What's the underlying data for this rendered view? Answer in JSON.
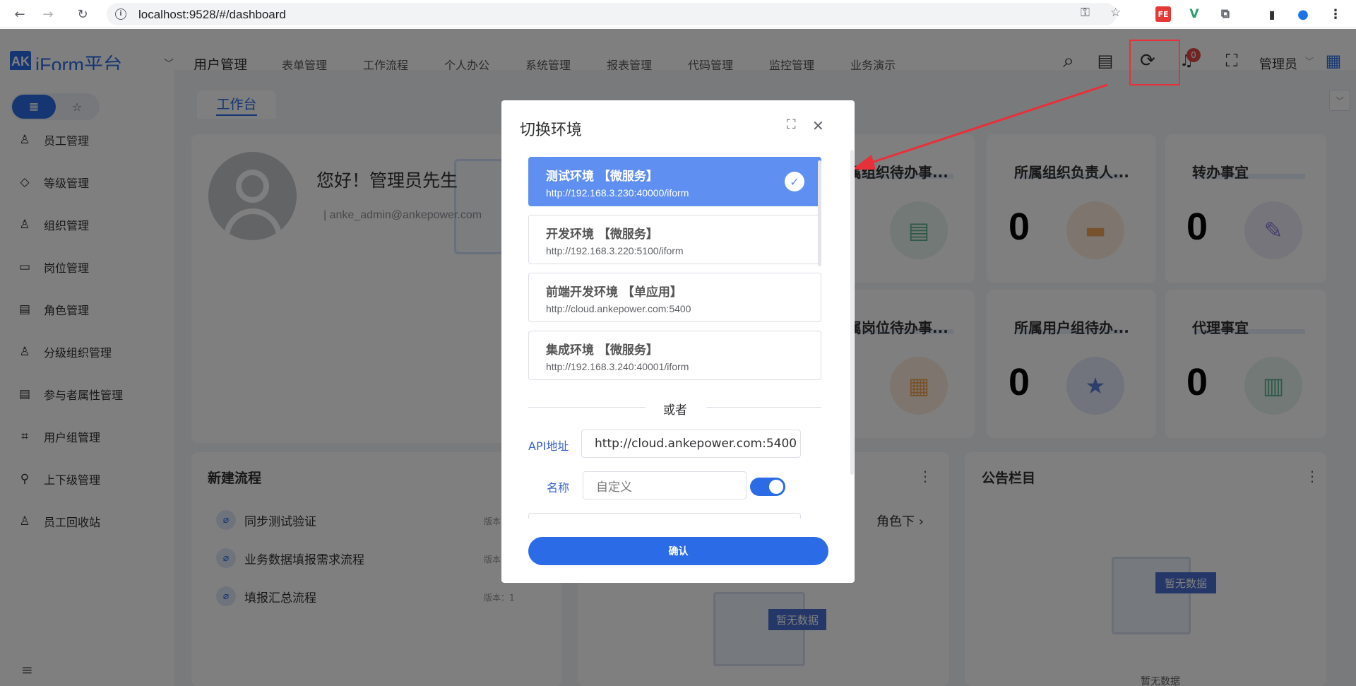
{
  "browser": {
    "url": "localhost:9528/#/dashboard",
    "back_icon": "←",
    "forward_icon": "→",
    "reload_icon": "↻",
    "info_icon": "i",
    "key_icon": "⚿",
    "star_icon": "☆",
    "ext_fe_label": "FE",
    "ext_vue_label": "V",
    "puzzle_icon": "⧉",
    "sidepanel_icon": "▮",
    "profile_icon": "●",
    "kebab_icon": "⋮"
  },
  "header": {
    "logo_mark": "AK",
    "logo_text": "iForm平台",
    "menu_caret": "﹀",
    "menu": [
      "用户管理",
      "表单管理",
      "工作流程",
      "个人办公",
      "系统管理",
      "报表管理",
      "代码管理",
      "监控管理",
      "业务演示"
    ],
    "notification_count": "0",
    "user_name": "管理员",
    "user_caret": "﹀",
    "search_icon": "⌕",
    "doc_icon": "▤",
    "switch_env_icon": "⟳",
    "bell_icon": "♫",
    "fullscreen_icon": "⛶",
    "apps_icon": "▦"
  },
  "sidebar": {
    "toggle_grid_icon": "▦",
    "toggle_star_icon": "☆",
    "items": [
      {
        "icon": "♙",
        "label": "员工管理"
      },
      {
        "icon": "◇",
        "label": "等级管理"
      },
      {
        "icon": "♙",
        "label": "组织管理"
      },
      {
        "icon": "▭",
        "label": "岗位管理"
      },
      {
        "icon": "▤",
        "label": "角色管理"
      },
      {
        "icon": "♙",
        "label": "分级组织管理"
      },
      {
        "icon": "▤",
        "label": "参与者属性管理"
      },
      {
        "icon": "⌗",
        "label": "用户组管理"
      },
      {
        "icon": "⚲",
        "label": "上下级管理"
      },
      {
        "icon": "♙",
        "label": "员工回收站"
      }
    ],
    "collapse_icon": "≡"
  },
  "tabs": {
    "active": "工作台",
    "dropdown_icon": "﹀"
  },
  "welcome": {
    "greeting": "您好！管理员先生",
    "email": "| anke_admin@ankepower.com"
  },
  "stats": [
    {
      "title": "属组织待办事...",
      "value": "",
      "icon": "▤"
    },
    {
      "title": "所属组织负责人...",
      "value": "0",
      "icon": "▬"
    },
    {
      "title": "转办事宜",
      "value": "0",
      "icon": "✎"
    },
    {
      "title": "属岗位待办事...",
      "value": "",
      "icon": "▦"
    },
    {
      "title": "所属用户组待办...",
      "value": "0",
      "icon": "★"
    },
    {
      "title": "代理事宜",
      "value": "0",
      "icon": "▥"
    }
  ],
  "new_flow": {
    "title": "新建流程",
    "kebab": "⋮",
    "flow_icon": "⌀",
    "items": [
      {
        "label": "同步测试验证",
        "version": "版本"
      },
      {
        "label": "业务数据填报需求流程",
        "version": "版本"
      },
      {
        "label": "填报汇总流程",
        "version": "版本：1"
      }
    ]
  },
  "middle_panel": {
    "kebab": "⋮",
    "role_link": "角色下 ›",
    "empty_tag": "暂无数据"
  },
  "notice": {
    "title": "公告栏目",
    "kebab": "⋮",
    "empty_tag": "暂无数据",
    "empty_text": "暂无数据"
  },
  "modal": {
    "title": "切换环境",
    "fullscreen_icon": "⛶",
    "close_icon": "✕",
    "check_icon": "✓",
    "environments": [
      {
        "name": "测试环境 【微服务】",
        "url": "http://192.168.3.230:40000/iform",
        "selected": true
      },
      {
        "name": "开发环境 【微服务】",
        "url": "http://192.168.3.220:5100/iform",
        "selected": false
      },
      {
        "name": "前端开发环境 【单应用】",
        "url": "http://cloud.ankepower.com:5400",
        "selected": false
      },
      {
        "name": "集成环境 【微服务】",
        "url": "http://192.168.3.240:40001/iform",
        "selected": false
      }
    ],
    "divider_text": "或者",
    "api_label": "API地址",
    "api_value": "http://cloud.ankepower.com:5400",
    "name_label": "名称",
    "name_placeholder": "自定义",
    "toggle_on": true,
    "confirm_label": "确认"
  },
  "colors": {
    "brand": "#2b6ce6",
    "selected_env": "#5f8ff0",
    "annotation_red": "#e8303a"
  }
}
